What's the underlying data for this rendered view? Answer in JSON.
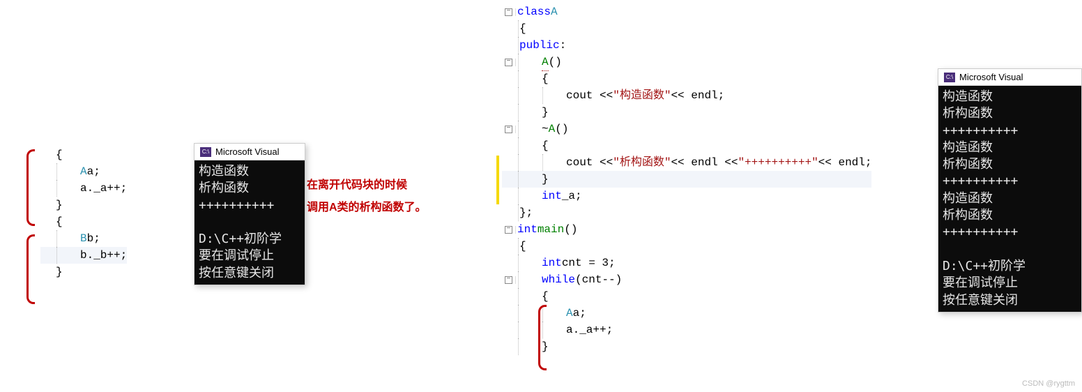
{
  "annotation": {
    "line1": "在离开代码块的时候",
    "line2": "调用A类的析构函数了。"
  },
  "left_code": {
    "l1": "{",
    "l2_type": "A",
    "l2_rest": " a;",
    "l3": "a._a++;",
    "l4": "}",
    "l5": "{",
    "l6_type": "B",
    "l6_rest": " b;",
    "l7": "b._b++;",
    "l8": "}"
  },
  "center_code": {
    "class_kw": "class",
    "class_name": " A",
    "brace_o": "{",
    "public_kw": "public",
    "colon": ":",
    "ctor": "A",
    "ctor_par": "()",
    "brace_o2": "{",
    "cout1a": "cout << ",
    "cout1s": "\"构造函数\"",
    "cout1b": " << endl;",
    "brace_c2": "}",
    "dtorpre": "~",
    "dtor": "A",
    "dtor_par": "()",
    "brace_o3": "{",
    "cout2a": "cout << ",
    "cout2s1": "\"析构函数\"",
    "cout2m": " << endl << ",
    "cout2s2": "\"++++++++++\"",
    "cout2b": " << endl;",
    "brace_c3": "}",
    "int_kw": "int",
    "memb": " _a;",
    "class_end": "};",
    "int_kw2": "int",
    "main_fn": " main",
    "main_par": "()",
    "brace_o4": "{",
    "int_kw3": "int",
    "cnt_decl": " cnt = 3;",
    "while_kw": "while",
    "while_cond": "(cnt--)",
    "brace_o5": "{",
    "Atype": "A",
    "arest": " a;",
    "a_inc": "a._a++;",
    "brace_c5": "}"
  },
  "console1": {
    "title": "Microsoft Visual",
    "body": "构造函数\n析构函数\n++++++++++\n\nD:\\C++初阶学\n要在调试停止\n按任意键关闭"
  },
  "console2": {
    "title": "Microsoft Visual",
    "body": "构造函数\n析构函数\n++++++++++\n构造函数\n析构函数\n++++++++++\n构造函数\n析构函数\n++++++++++\n\nD:\\C++初阶学\n要在调试停止\n按任意键关闭"
  },
  "watermark": "CSDN @rygttm"
}
